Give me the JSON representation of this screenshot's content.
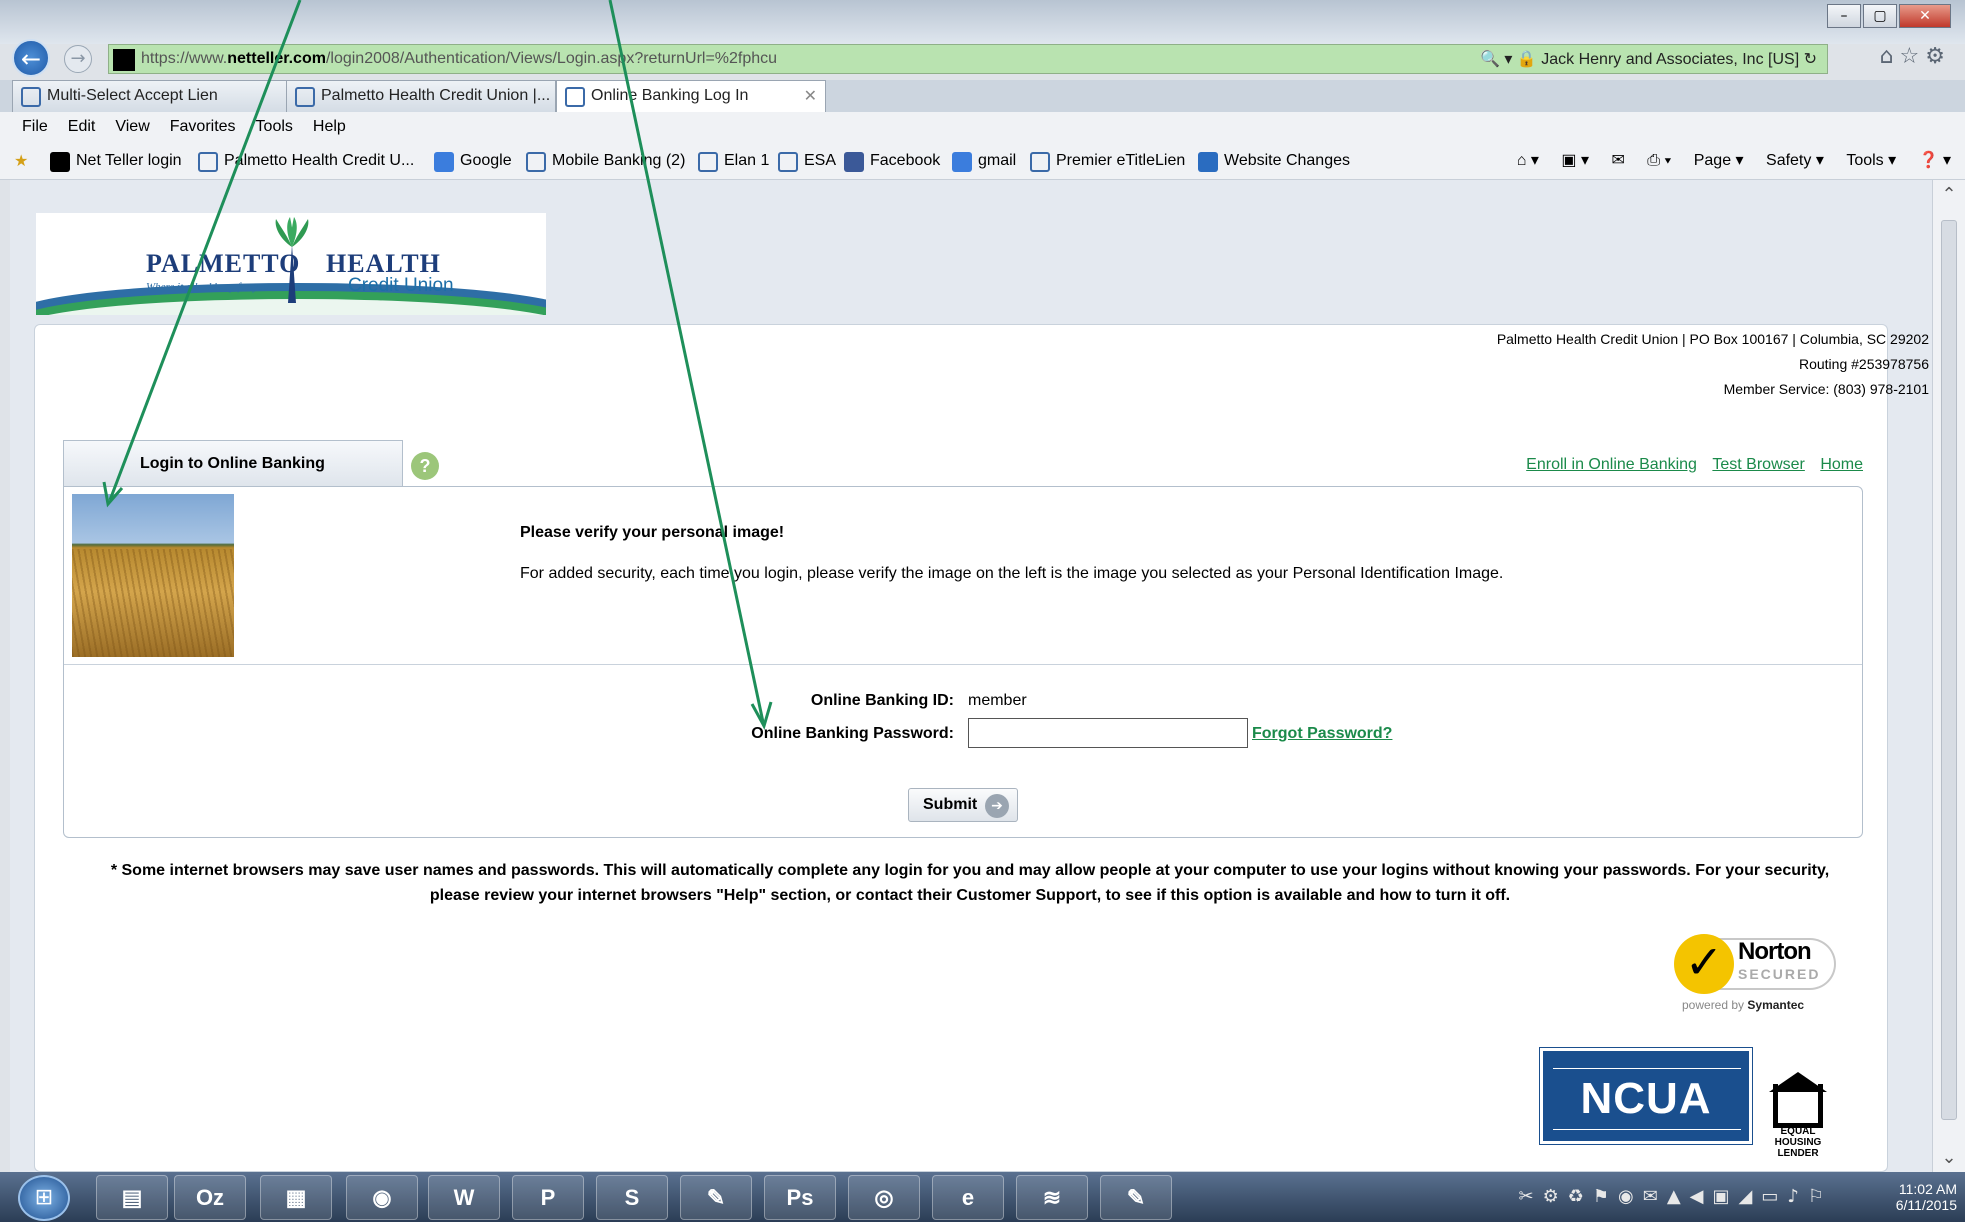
{
  "browser": {
    "url_prefix": "https://www.",
    "url_domain": "netteller.com",
    "url_path": "/login2008/Authentication/Views/Login.aspx?returnUrl=%2fphcu",
    "cert_name": "Jack Henry and Associates, Inc [US]",
    "tabs": [
      {
        "label": "Multi-Select Accept Lien"
      },
      {
        "label": "Palmetto Health Credit Union |..."
      },
      {
        "label": "Online Banking Log In"
      }
    ],
    "menu": [
      "File",
      "Edit",
      "View",
      "Favorites",
      "Tools",
      "Help"
    ],
    "favorites": [
      "Net Teller login",
      "Palmetto Health Credit U...",
      "Google",
      "Mobile Banking (2)",
      "Elan 1",
      "ESA",
      "Facebook",
      "gmail",
      "Premier eTitleLien",
      "Website Changes"
    ],
    "commands": [
      "Page ▾",
      "Safety ▾",
      "Tools ▾"
    ]
  },
  "logo": {
    "name_left": "PALMETTO",
    "name_right": "HEALTH",
    "tagline": "Where it all adds up for you.",
    "sub": "Credit Union"
  },
  "contact": {
    "line1": "Palmetto Health Credit Union | PO Box 100167 | Columbia, SC 29202",
    "line2": "Routing #253978756",
    "line3": "Member Service: (803) 978-2101"
  },
  "login": {
    "tab_label": "Login to Online Banking",
    "help_symbol": "?",
    "links": [
      "Enroll in Online Banking",
      "Test Browser",
      "Home"
    ],
    "verify_title": "Please verify your personal image!",
    "verify_text": "For added security, each time you login, please verify the image on the left is the image you selected as your Personal Identification Image.",
    "id_label": "Online Banking ID:",
    "id_value": "member",
    "password_label": "Online Banking Password:",
    "password_value": "",
    "forgot_label": "Forgot Password?",
    "submit_label": "Submit"
  },
  "notice": {
    "line1": "* Some internet browsers may save user names and passwords. This will automatically complete any login for you and may allow people at your computer to use your logins without knowing your passwords. For your security,",
    "line2": "please review your internet browsers \"Help\" section, or contact their Customer Support, to see if this option is available and how to turn it off."
  },
  "badges": {
    "norton_name": "Norton",
    "norton_secured": "SECURED",
    "norton_powered": "powered by",
    "norton_symantec": "Symantec",
    "ncua": "NCUA",
    "eho_text": "EQUAL HOUSING LENDER"
  },
  "taskbar": {
    "apps": [
      "",
      "Oz",
      "",
      "",
      "W",
      "P",
      "S",
      "",
      "Ps",
      "",
      "",
      "",
      ""
    ],
    "time": "11:02 AM",
    "date": "6/11/2015"
  },
  "colors": {
    "link_green": "#1b8a4a",
    "arrow_green": "#1e8f5a",
    "address_bar": "#b9e3b0",
    "ncua_blue": "#1a4f8e"
  }
}
